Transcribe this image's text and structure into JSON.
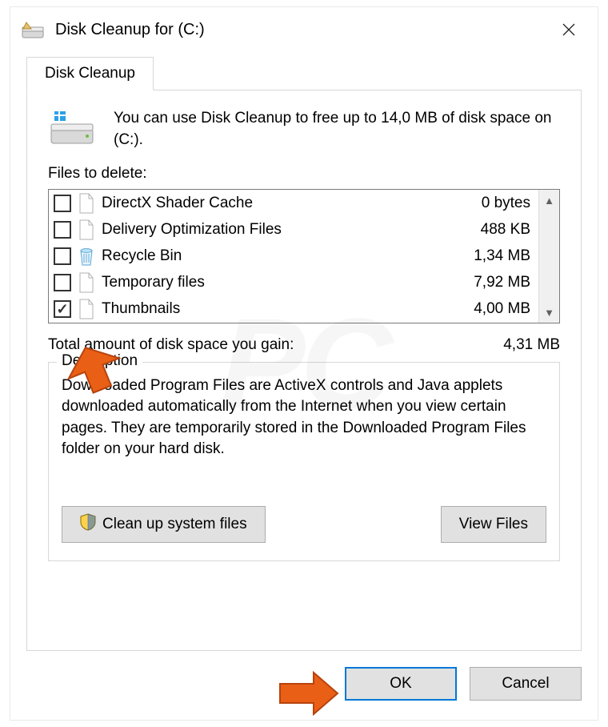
{
  "title": "Disk Cleanup for  (C:)",
  "tab": "Disk Cleanup",
  "intro": "You can use Disk Cleanup to free up to 14,0 MB of disk space on  (C:).",
  "files_label": "Files to delete:",
  "items": [
    {
      "label": "DirectX Shader Cache",
      "size": "0 bytes",
      "checked": false,
      "icon": "file"
    },
    {
      "label": "Delivery Optimization Files",
      "size": "488 KB",
      "checked": false,
      "icon": "file"
    },
    {
      "label": "Recycle Bin",
      "size": "1,34 MB",
      "checked": false,
      "icon": "bin"
    },
    {
      "label": "Temporary files",
      "size": "7,92 MB",
      "checked": false,
      "icon": "file"
    },
    {
      "label": "Thumbnails",
      "size": "4,00 MB",
      "checked": true,
      "icon": "file"
    }
  ],
  "total_label": "Total amount of disk space you gain:",
  "total_value": "4,31 MB",
  "description_heading": "Description",
  "description_text": "Downloaded Program Files are ActiveX controls and Java applets downloaded automatically from the Internet when you view certain pages. They are temporarily stored in the Downloaded Program Files folder on your hard disk.",
  "cleanup_btn": "Clean up system files",
  "view_btn": "View Files",
  "ok": "OK",
  "cancel": "Cancel"
}
